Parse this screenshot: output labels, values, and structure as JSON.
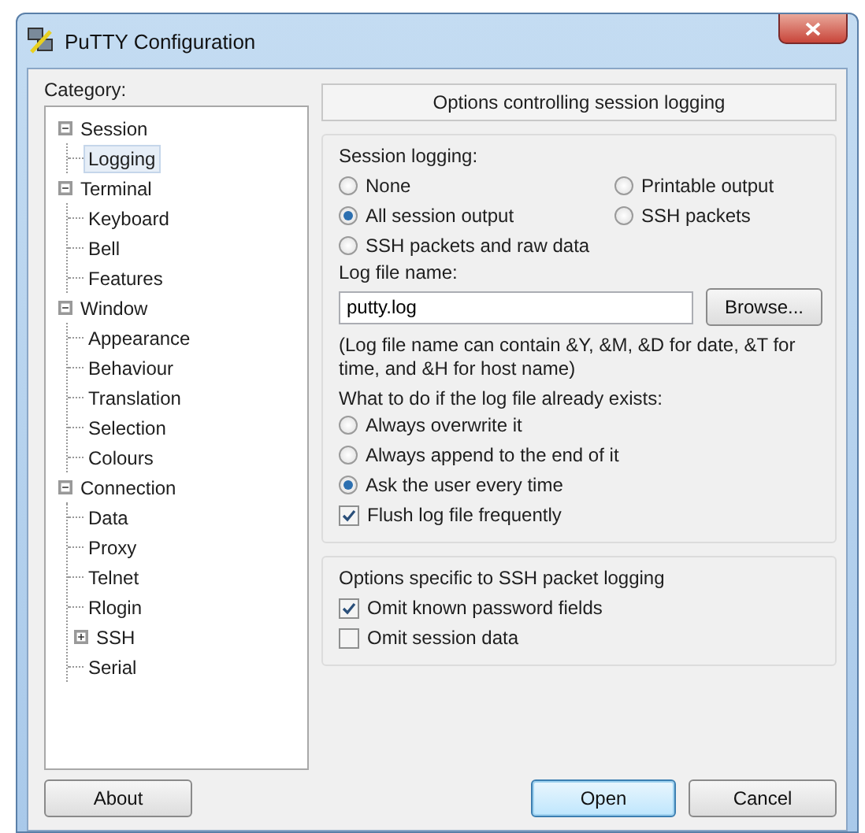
{
  "window": {
    "title": "PuTTY Configuration"
  },
  "category_label": "Category:",
  "tree": [
    {
      "label": "Session",
      "expanded": true,
      "selected": false,
      "children": [
        {
          "label": "Logging",
          "selected": true
        }
      ]
    },
    {
      "label": "Terminal",
      "expanded": true,
      "selected": false,
      "children": [
        {
          "label": "Keyboard",
          "selected": false
        },
        {
          "label": "Bell",
          "selected": false
        },
        {
          "label": "Features",
          "selected": false
        }
      ]
    },
    {
      "label": "Window",
      "expanded": true,
      "selected": false,
      "children": [
        {
          "label": "Appearance",
          "selected": false
        },
        {
          "label": "Behaviour",
          "selected": false
        },
        {
          "label": "Translation",
          "selected": false
        },
        {
          "label": "Selection",
          "selected": false
        },
        {
          "label": "Colours",
          "selected": false
        }
      ]
    },
    {
      "label": "Connection",
      "expanded": true,
      "selected": false,
      "children": [
        {
          "label": "Data",
          "selected": false
        },
        {
          "label": "Proxy",
          "selected": false
        },
        {
          "label": "Telnet",
          "selected": false
        },
        {
          "label": "Rlogin",
          "selected": false
        },
        {
          "label": "SSH",
          "expanded": false,
          "selected": false
        },
        {
          "label": "Serial",
          "selected": false
        }
      ]
    }
  ],
  "panel_header": "Options controlling session logging",
  "session_logging": {
    "label": "Session logging:",
    "options": [
      {
        "label": "None",
        "selected": false
      },
      {
        "label": "Printable output",
        "selected": false
      },
      {
        "label": "All session output",
        "selected": true
      },
      {
        "label": "SSH packets",
        "selected": false
      },
      {
        "label": "SSH packets and raw data",
        "selected": false
      }
    ]
  },
  "log_file": {
    "label": "Log file name:",
    "value": "putty.log",
    "browse": "Browse...",
    "hint": "(Log file name can contain &Y, &M, &D for date, &T for time, and &H for host name)"
  },
  "exists": {
    "label": "What to do if the log file already exists:",
    "options": [
      {
        "label": "Always overwrite it",
        "selected": false
      },
      {
        "label": "Always append to the end of it",
        "selected": false
      },
      {
        "label": "Ask the user every time",
        "selected": true
      }
    ]
  },
  "flush": {
    "label": "Flush log file frequently",
    "checked": true
  },
  "ssh_group": {
    "title": "Options specific to SSH packet logging",
    "options": [
      {
        "label": "Omit known password fields",
        "checked": true
      },
      {
        "label": "Omit session data",
        "checked": false
      }
    ]
  },
  "buttons": [
    {
      "label": "About",
      "kind": "plain"
    },
    {
      "label": "Open",
      "kind": "default"
    },
    {
      "label": "Cancel",
      "kind": "plain"
    }
  ]
}
